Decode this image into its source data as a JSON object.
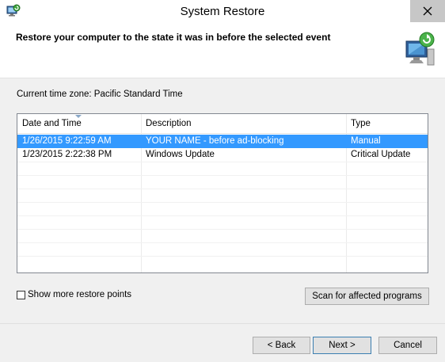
{
  "window": {
    "title": "System Restore",
    "app_icon": "system-restore-icon",
    "close_icon": "close-icon"
  },
  "header": {
    "text": "Restore your computer to the state it was in before the selected event",
    "icon": "computer-restore-icon"
  },
  "timezone_text": "Current time zone: Pacific Standard Time",
  "table": {
    "columns": [
      "Date and Time",
      "Description",
      "Type"
    ],
    "sorted_column": "Date and Time",
    "rows": [
      {
        "date": "1/26/2015 9:22:59 AM",
        "description": "YOUR NAME - before ad-blocking",
        "type": "Manual",
        "selected": true
      },
      {
        "date": "1/23/2015 2:22:38 PM",
        "description": "Windows Update",
        "type": "Critical Update",
        "selected": false
      }
    ]
  },
  "show_more": {
    "label": "Show more restore points",
    "checked": false
  },
  "buttons": {
    "scan": "Scan for affected programs",
    "back": "< Back",
    "next": "Next >",
    "cancel": "Cancel"
  },
  "colors": {
    "selection": "#3399ff",
    "dialog_bg": "#f0f0f0",
    "default_button_border": "#3c7fb1"
  }
}
